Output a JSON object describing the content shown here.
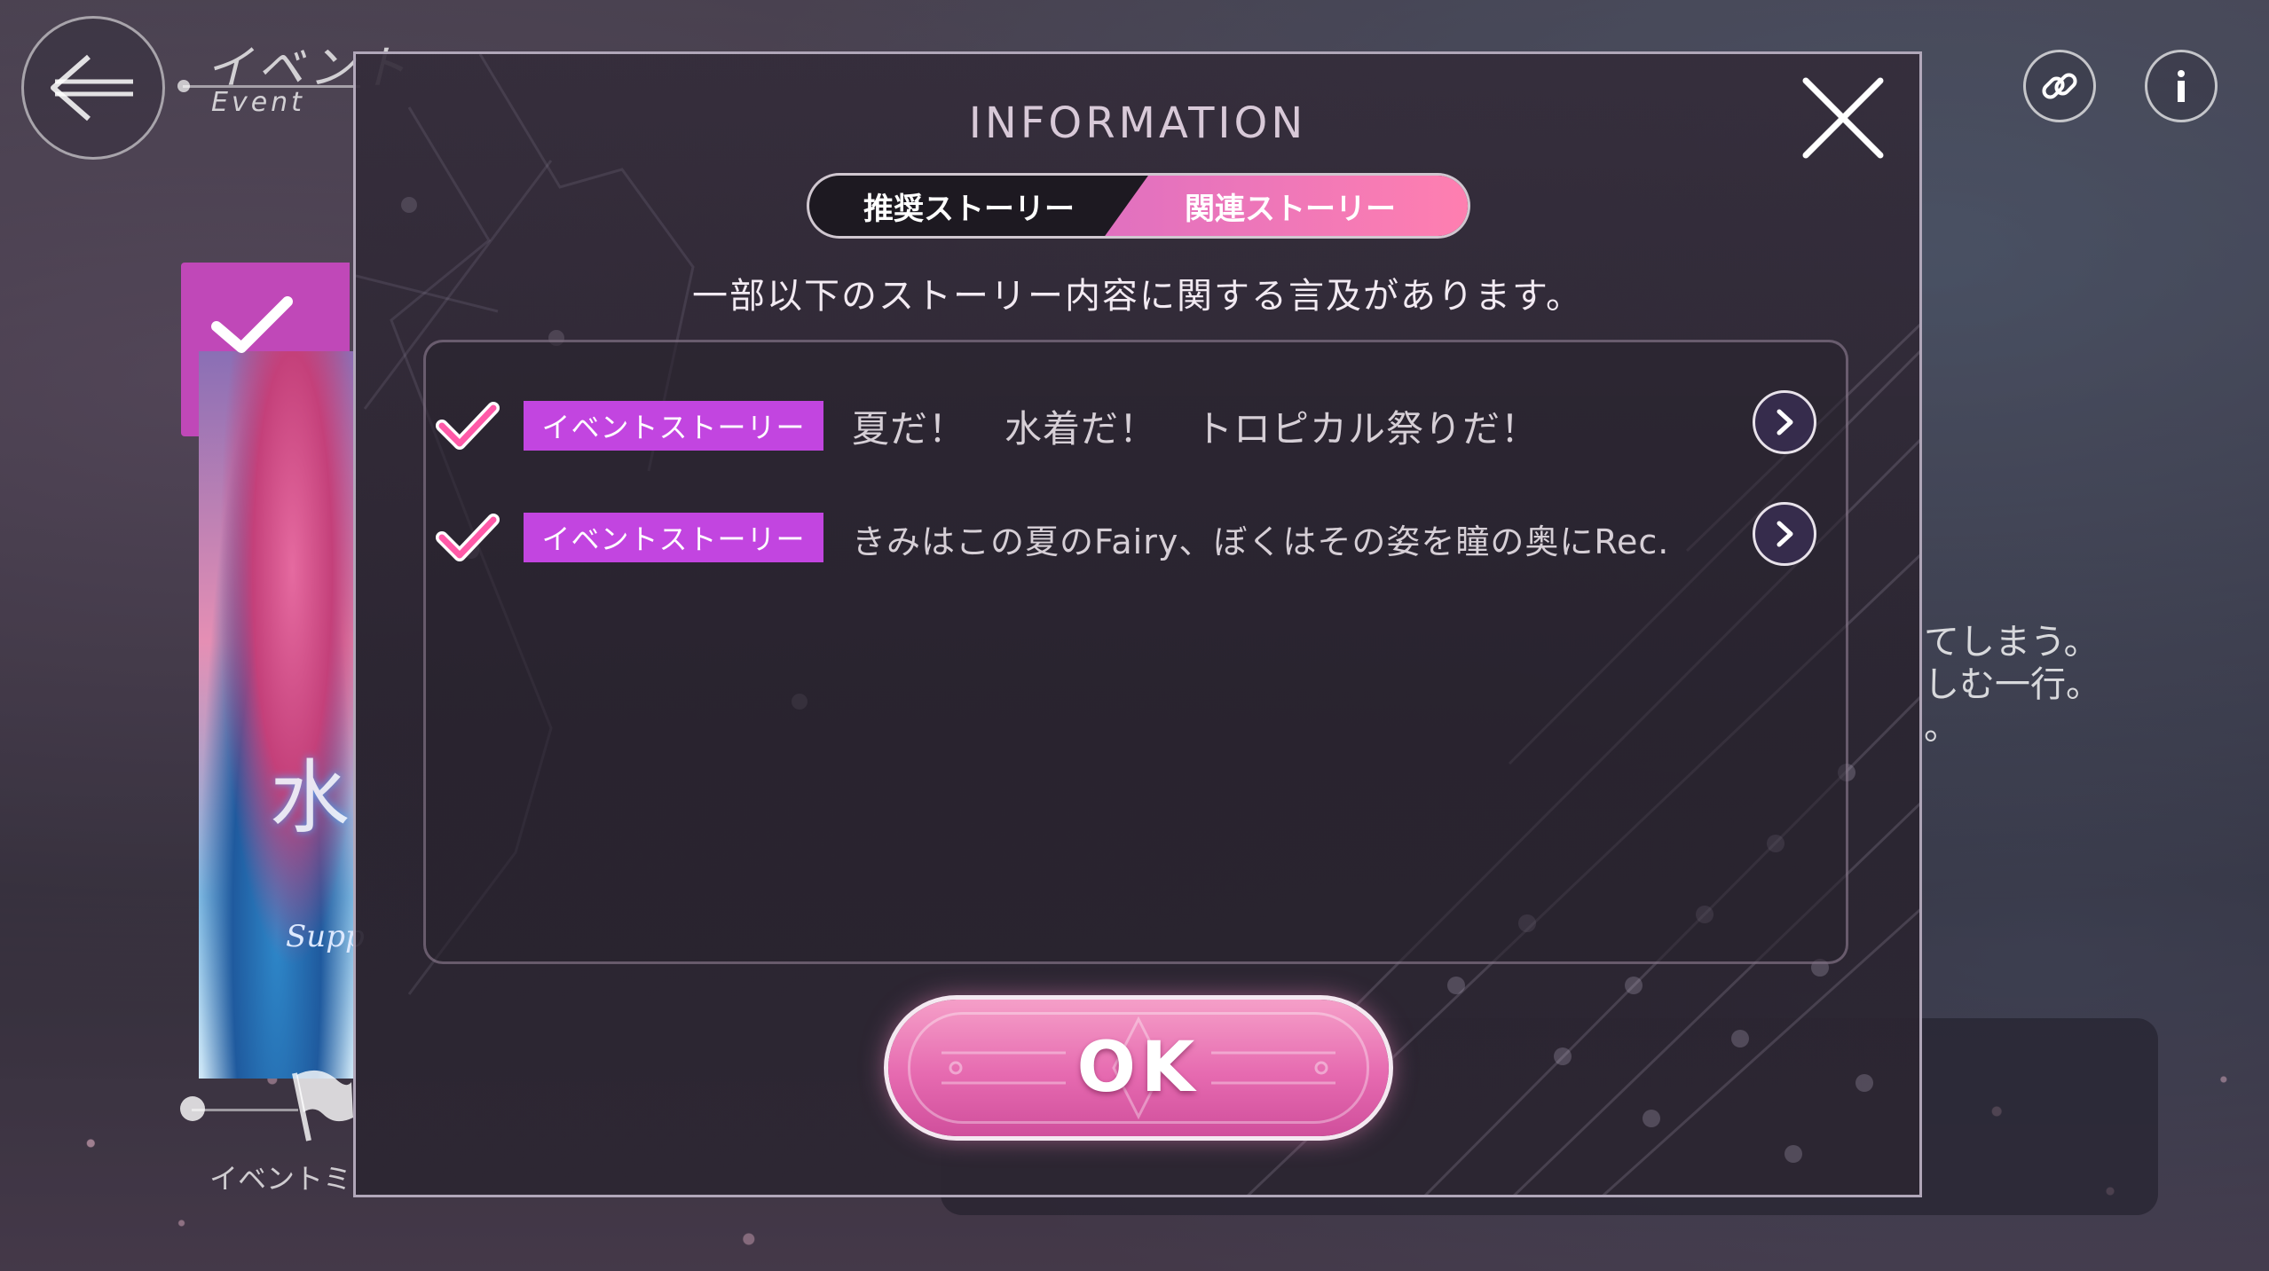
{
  "header": {
    "title": "イベント",
    "subtitle": "Event"
  },
  "background": {
    "side_text_lines": [
      "てしまう。",
      "しむ一行。",
      "。"
    ],
    "event_menu_label": "イベントミ",
    "card_deco_text": "水",
    "card_sub_text": "Supp"
  },
  "modal": {
    "title": "INFORMATION",
    "tabs": [
      {
        "label": "推奨ストーリー",
        "active": false
      },
      {
        "label": "関連ストーリー",
        "active": true
      }
    ],
    "notice": "一部以下のストーリー内容に関する言及があります。",
    "stories": [
      {
        "badge": "イベントストーリー",
        "title": "夏だ！　水着だ！　トロピカル祭りだ！",
        "checked": true
      },
      {
        "badge": "イベントストーリー",
        "title": "きみはこの夏のFairy、ぼくはその姿を瞳の奥にRec.",
        "checked": true
      }
    ],
    "ok_label": "OK"
  },
  "icons": {
    "back": "back-arrow-icon",
    "link": "link-icon",
    "info": "info-icon",
    "close": "close-icon",
    "check": "check-icon",
    "chevron": "chevron-right-icon"
  },
  "colors": {
    "accent_pink": "#ff7fb0",
    "badge_purple": "#c245e0",
    "check_pink": "#ff5aa8"
  }
}
